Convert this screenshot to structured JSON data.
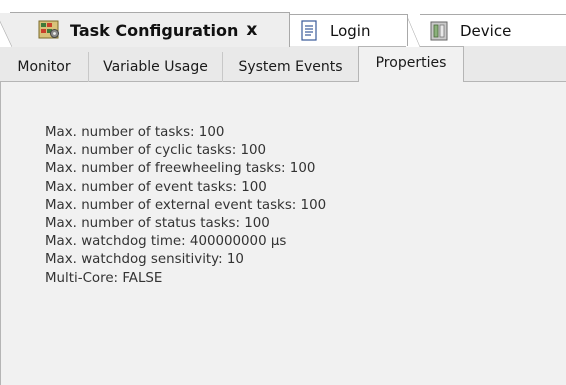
{
  "document_tabs": [
    {
      "label": "Task Configuration",
      "icon": "task-configuration-icon",
      "active": true,
      "close": "x"
    },
    {
      "label": "Login",
      "icon": "document-icon",
      "active": false
    },
    {
      "label": "Device",
      "icon": "device-icon",
      "active": false
    }
  ],
  "editor_tabs": [
    {
      "label": "Monitor"
    },
    {
      "label": "Variable Usage"
    },
    {
      "label": "System Events"
    },
    {
      "label": "Properties",
      "active": true
    }
  ],
  "properties": [
    "Max. number of tasks: 100",
    "Max. number of cyclic tasks: 100",
    "Max. number of freewheeling tasks: 100",
    "Max. number of event tasks: 100",
    "Max. number of external event tasks: 100",
    "Max. number of status tasks: 100",
    "Max. watchdog time: 400000000 µs",
    "Max. watchdog sensitivity: 10",
    "Multi-Core: FALSE"
  ],
  "colors": {
    "panel_bg": "#f1f1f1",
    "tab_strip_bg": "#e9e9e9",
    "text": "#333333"
  }
}
